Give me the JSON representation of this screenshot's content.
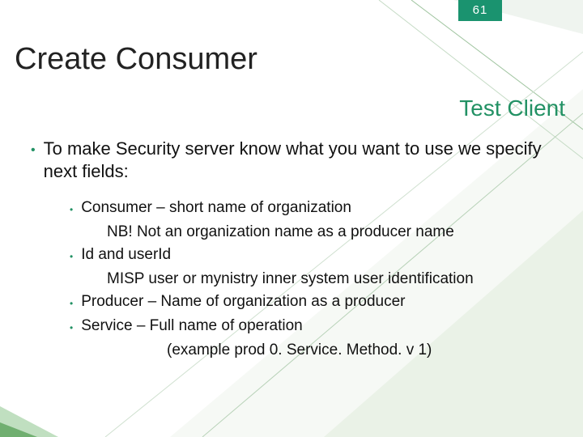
{
  "page_number": "61",
  "title": "Create Consumer",
  "subtitle": "Test Client",
  "main_bullet": "To make Security server know what you want to use we specify next fields:",
  "items": [
    {
      "head": "Consumer – short name of organization",
      "sub": "NB! Not an organization name as a producer name"
    },
    {
      "head": "Id and userId",
      "sub": "MISP user or mynistry inner system user identification"
    },
    {
      "head": "Producer – Name of organization as a producer",
      "sub": ""
    },
    {
      "head": "Service – Full name of operation",
      "sub": "(example prod 0. Service. Method. v 1)"
    }
  ]
}
